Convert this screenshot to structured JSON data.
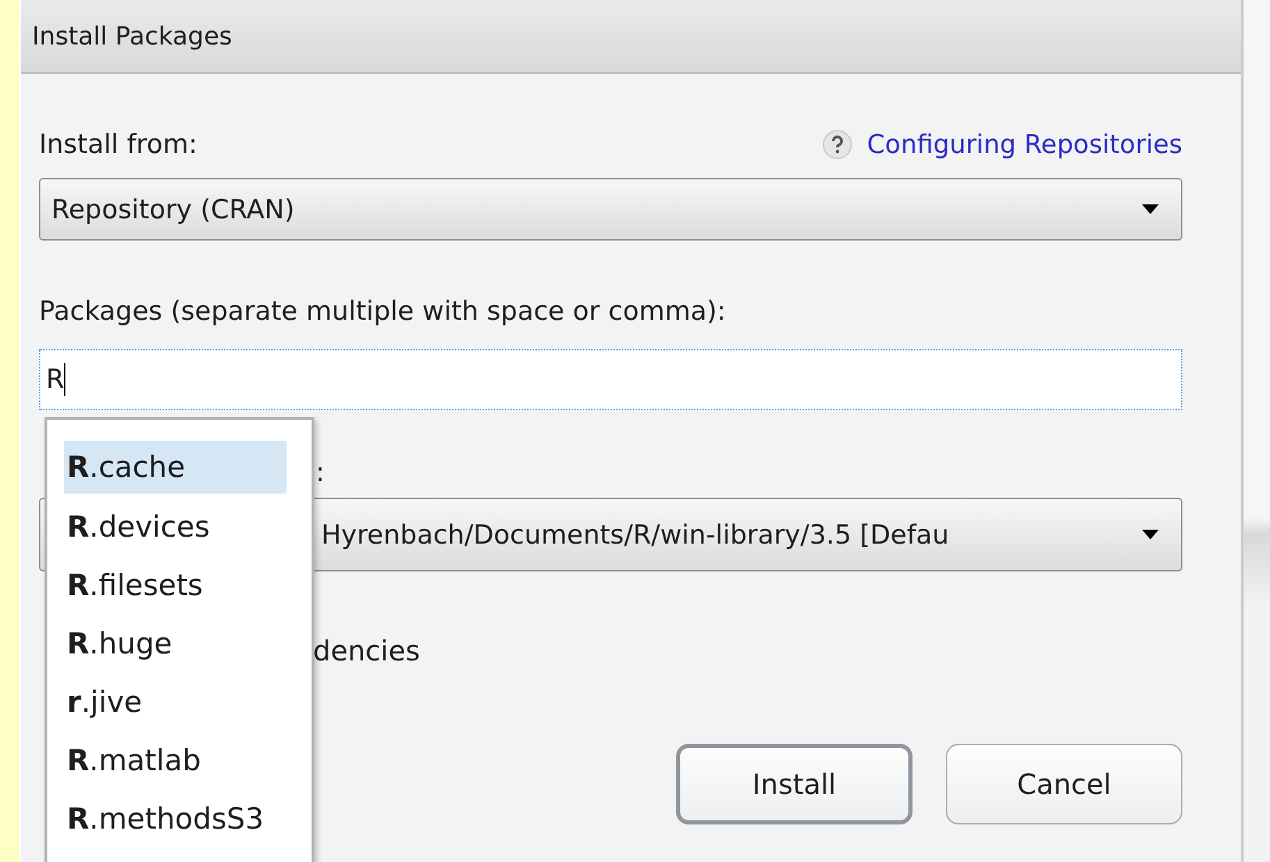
{
  "window": {
    "title": "Install Packages"
  },
  "install_from": {
    "label": "Install from:",
    "help_link": "Configuring Repositories",
    "value": "Repository (CRAN)"
  },
  "packages": {
    "label": "Packages (separate multiple with space or comma):",
    "value": "R"
  },
  "library": {
    "label": ":",
    "value": "Hyrenbach/Documents/R/win-library/3.5 [Defau"
  },
  "dependencies": {
    "label": "dencies"
  },
  "suggestions": [
    {
      "text": "**R**.cache",
      "selected": true
    },
    {
      "text": "**R**.devices",
      "selected": false
    },
    {
      "text": "**R**.filesets",
      "selected": false
    },
    {
      "text": "**R**.huge",
      "selected": false
    },
    {
      "text": "**r**.jive",
      "selected": false
    },
    {
      "text": "**R**.matlab",
      "selected": false
    },
    {
      "text": "**R**.methodsS3",
      "selected": false
    }
  ],
  "buttons": [
    {
      "label": "Install",
      "kind": "default"
    },
    {
      "label": "Cancel",
      "kind": "normal"
    }
  ]
}
